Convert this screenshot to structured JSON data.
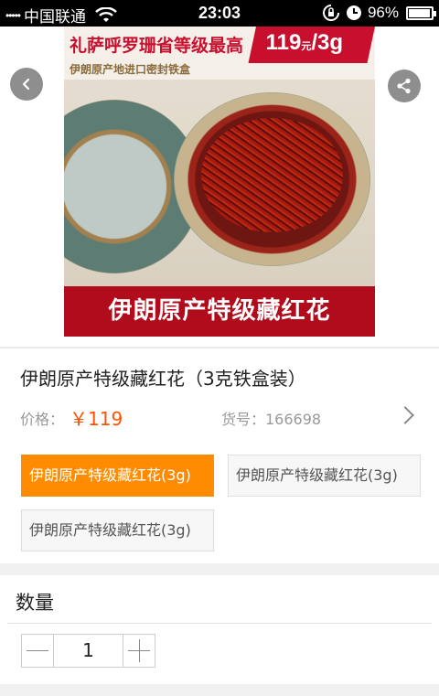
{
  "status_bar": {
    "signal": "•••••",
    "carrier": "中国联通",
    "time": "23:03",
    "battery_percent": "96%",
    "battery_level": 0.96
  },
  "hero": {
    "image_title": "礼萨呼罗珊省等级最高",
    "image_subtitle": "伊朗原产地进口密封铁盒",
    "image_price": "119",
    "image_price_unit": "元",
    "image_price_weight": "/3g",
    "image_bottom_text": "伊朗原产特级藏红花"
  },
  "product": {
    "name": "伊朗原产特级藏红花（3克铁盒装）",
    "price_label": "价格：",
    "price_value": "￥119",
    "sku_label": "货号：166698"
  },
  "options": [
    {
      "label": "伊朗原产特级藏红花(3g)",
      "selected": true
    },
    {
      "label": "伊朗原产特级藏红花(3g)",
      "selected": false
    },
    {
      "label": "伊朗原产特级藏红花(3g)",
      "selected": false
    }
  ],
  "quantity": {
    "title": "数量",
    "value": "1"
  },
  "colors": {
    "accent": "#ff8c00",
    "price": "#ff5000"
  },
  "icons": [
    "back-icon",
    "share-icon",
    "chevron-right-icon",
    "wifi-icon",
    "rotation-lock-icon",
    "alarm-icon",
    "battery-icon"
  ]
}
